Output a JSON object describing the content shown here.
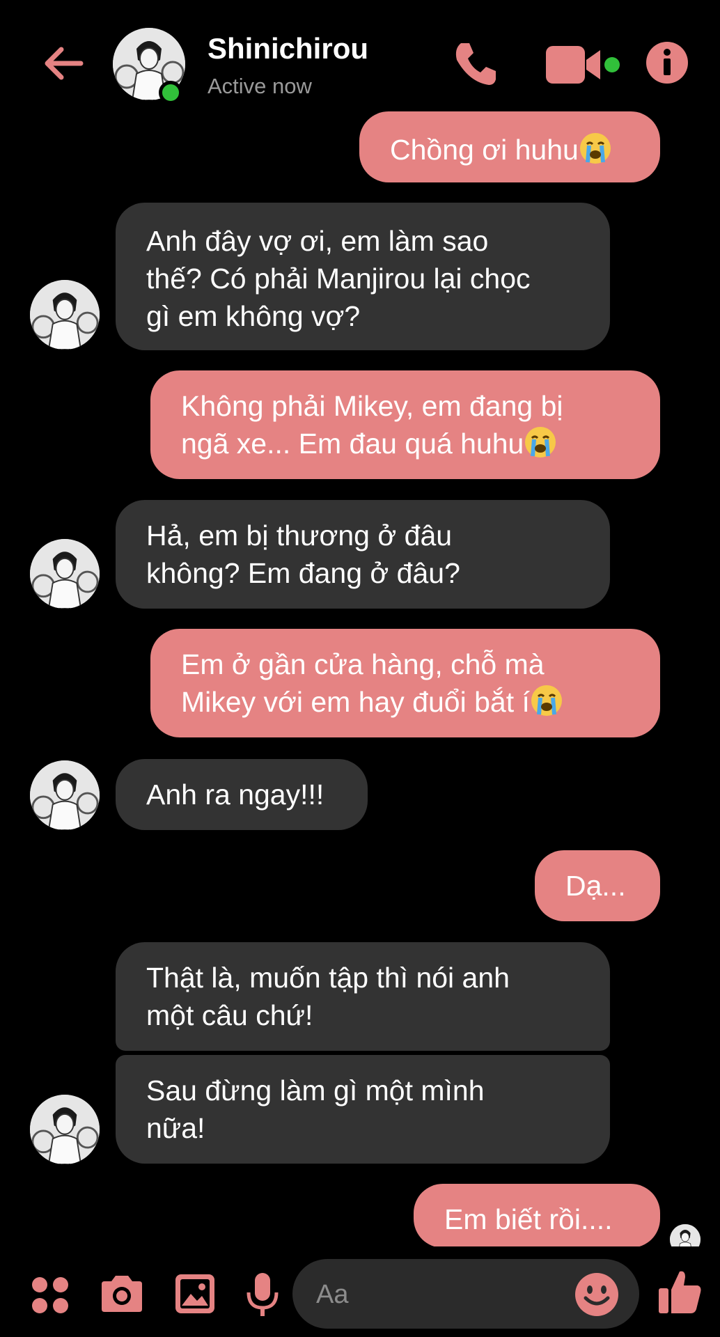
{
  "header": {
    "contact_name": "Shinichirou",
    "status": "Active now"
  },
  "messages": [
    {
      "side": "out",
      "text": "Chồng ơi huhu"
    },
    {
      "side": "in",
      "lines": [
        "Anh đây vợ ơi, em làm sao",
        "thế? Có phải Manjirou lại chọc",
        "gì em không vợ?"
      ]
    },
    {
      "side": "out",
      "lines": [
        "Không phải Mikey, em đang bị",
        "ngã xe... Em đau quá huhu"
      ]
    },
    {
      "side": "in",
      "lines": [
        "Hả, em bị thương ở đâu",
        "không? Em đang ở đâu?"
      ]
    },
    {
      "side": "out",
      "lines": [
        "Em ở gần cửa hàng, chỗ mà",
        "Mikey với em hay đuổi bắt í"
      ]
    },
    {
      "side": "in",
      "text": "Anh ra ngay!!!"
    },
    {
      "side": "out",
      "text": "Dạ..."
    },
    {
      "side": "in",
      "lines": [
        "Thật là, muốn tập thì nói anh",
        "một câu chứ!"
      ]
    },
    {
      "side": "in",
      "lines": [
        "Sau đừng làm gì một mình",
        "nữa!"
      ]
    },
    {
      "side": "out",
      "text": "Em biết rồi...."
    }
  ],
  "composer": {
    "placeholder": "Aa"
  },
  "colors": {
    "accent": "#e58383",
    "incoming_bubble": "#333333",
    "online": "#31c03a",
    "background": "#000000"
  },
  "icons": [
    "back-arrow-icon",
    "phone-icon",
    "video-camera-icon",
    "info-icon",
    "apps-icon",
    "camera-icon",
    "gallery-icon",
    "microphone-icon",
    "smile-icon",
    "thumbs-up-icon",
    "crying-face-emoji"
  ]
}
